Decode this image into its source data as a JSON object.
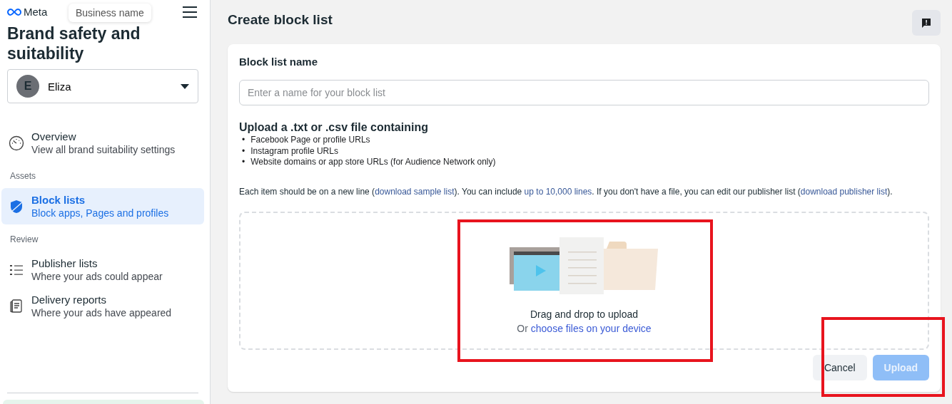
{
  "sidebar": {
    "logo": "Meta",
    "title": "Brand safety and suitability",
    "tooltip": "Business name",
    "account": {
      "initial": "E",
      "name": "Eliza"
    },
    "sections": [
      {
        "items": [
          {
            "kind": "gauge",
            "label": "Overview",
            "description": "View all brand suitability settings",
            "selected": false
          }
        ]
      },
      {
        "heading": "Assets",
        "items": [
          {
            "kind": "shield",
            "label": "Block lists",
            "description": "Block apps, Pages and profiles",
            "selected": true
          }
        ]
      },
      {
        "heading": "Review",
        "items": [
          {
            "kind": "list",
            "label": "Publisher lists",
            "description": "Where your ads could appear",
            "selected": false
          },
          {
            "kind": "report",
            "label": "Delivery reports",
            "description": "Where your ads have appeared",
            "selected": false
          }
        ]
      }
    ]
  },
  "header": {
    "title": "Create block list"
  },
  "form": {
    "name_label": "Block list name",
    "name_placeholder": "Enter a name for your block list",
    "upload_heading": "Upload a .txt or .csv file containing",
    "bullets": [
      {
        "marker": "•",
        "text": "Facebook Page or profile URLs"
      },
      {
        "marker": "•",
        "text": "Instagram profile URLs"
      },
      {
        "marker": "•",
        "text": "Website domains or app store URLs (for Audience Network only)"
      }
    ],
    "note": [
      {
        "kind": "text",
        "text": "Each item should be on a new line ("
      },
      {
        "kind": "link",
        "text": "download sample list"
      },
      {
        "kind": "text",
        "text": "). You can include "
      },
      {
        "kind": "link",
        "text": "up to 10,000 lines"
      },
      {
        "kind": "text",
        "text": ". If you don't have a file, you can edit our publisher list ("
      },
      {
        "kind": "link",
        "text": "download publisher list"
      },
      {
        "kind": "text",
        "text": ")."
      }
    ],
    "drop_title": "Drag and drop to upload",
    "drop_or": "Or",
    "drop_link": "choose files on your device"
  },
  "buttons": [
    {
      "kind": "secondary",
      "label": "Cancel"
    },
    {
      "kind": "primary",
      "label": "Upload",
      "disabled": true
    }
  ]
}
